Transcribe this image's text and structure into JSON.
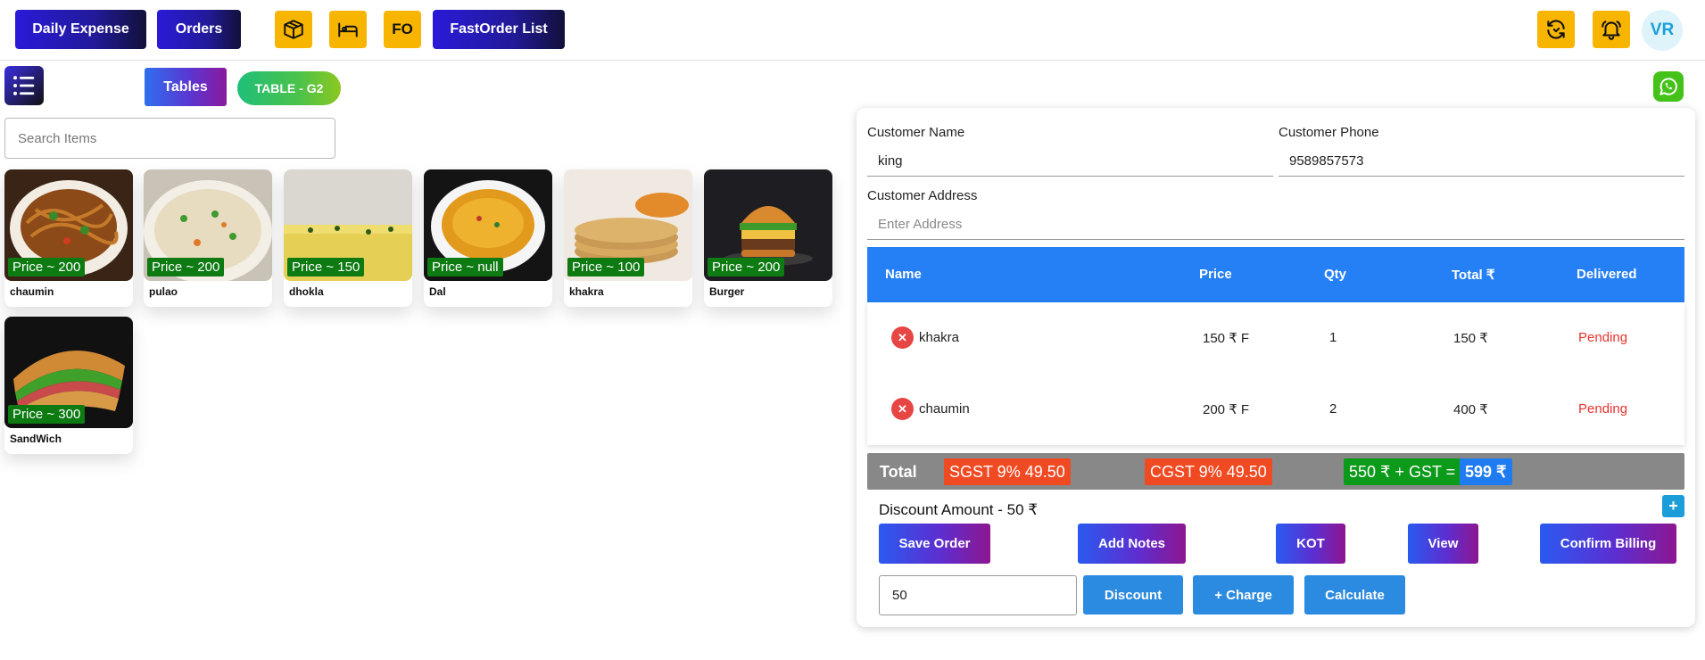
{
  "topbar": {
    "daily_expense": "Daily Expense",
    "orders": "Orders",
    "fo": "FO",
    "fastorder_list": "FastOrder List",
    "avatar_initials": "VR",
    "icons": [
      "box-icon",
      "bed-icon",
      "refresh-icon",
      "bell-icon"
    ]
  },
  "subbar": {
    "tables_label": "Tables",
    "table_pill": "TABLE - G2"
  },
  "search": {
    "placeholder": "Search Items",
    "value": ""
  },
  "items": [
    {
      "name": "chaumin",
      "price": "Price ~ 200"
    },
    {
      "name": "pulao",
      "price": "Price ~ 200"
    },
    {
      "name": "dhokla",
      "price": "Price ~ 150"
    },
    {
      "name": "Dal",
      "price": "Price ~ null"
    },
    {
      "name": "khakra",
      "price": "Price ~ 100"
    },
    {
      "name": "Burger",
      "price": "Price ~ 200"
    },
    {
      "name": "SandWich",
      "price": "Price ~ 300"
    }
  ],
  "customer": {
    "name_label": "Customer Name",
    "name_value": "king",
    "phone_label": "Customer Phone",
    "phone_value": "9589857573",
    "address_label": "Customer Address",
    "address_placeholder": "Enter Address"
  },
  "order_table": {
    "headers": [
      "Name",
      "Price",
      "Qty",
      "Total ₹",
      "Delivered"
    ],
    "rows": [
      {
        "name": "khakra",
        "price": "150 ₹ F",
        "qty": "1",
        "total": "150 ₹",
        "status": "Pending"
      },
      {
        "name": "chaumin",
        "price": "200 ₹ F",
        "qty": "2",
        "total": "400 ₹",
        "status": "Pending"
      }
    ]
  },
  "totals": {
    "label": "Total",
    "sgst": "SGST 9% 49.50",
    "cgst": "CGST 9% 49.50",
    "subtotal": "550 ₹ + GST =",
    "grand": "599 ₹"
  },
  "discount_amount": "Discount Amount - 50 ₹",
  "actions": {
    "save_order": "Save Order",
    "add_notes": "Add Notes",
    "kot": "KOT",
    "view": "View",
    "confirm_billing": "Confirm Billing",
    "plus": "+"
  },
  "discount_controls": {
    "input_value": "50",
    "discount": "Discount",
    "charge": "+ Charge",
    "calculate": "Calculate"
  },
  "colors": {
    "header_blue": "#2680f5",
    "price_green": "#0d7a12",
    "tax_orange": "#f04a23",
    "subtotal_green": "#0c9a1a",
    "grand_blue": "#1f7cf0",
    "pending_red": "#e8322c",
    "icon_yellow": "#f7b500"
  }
}
